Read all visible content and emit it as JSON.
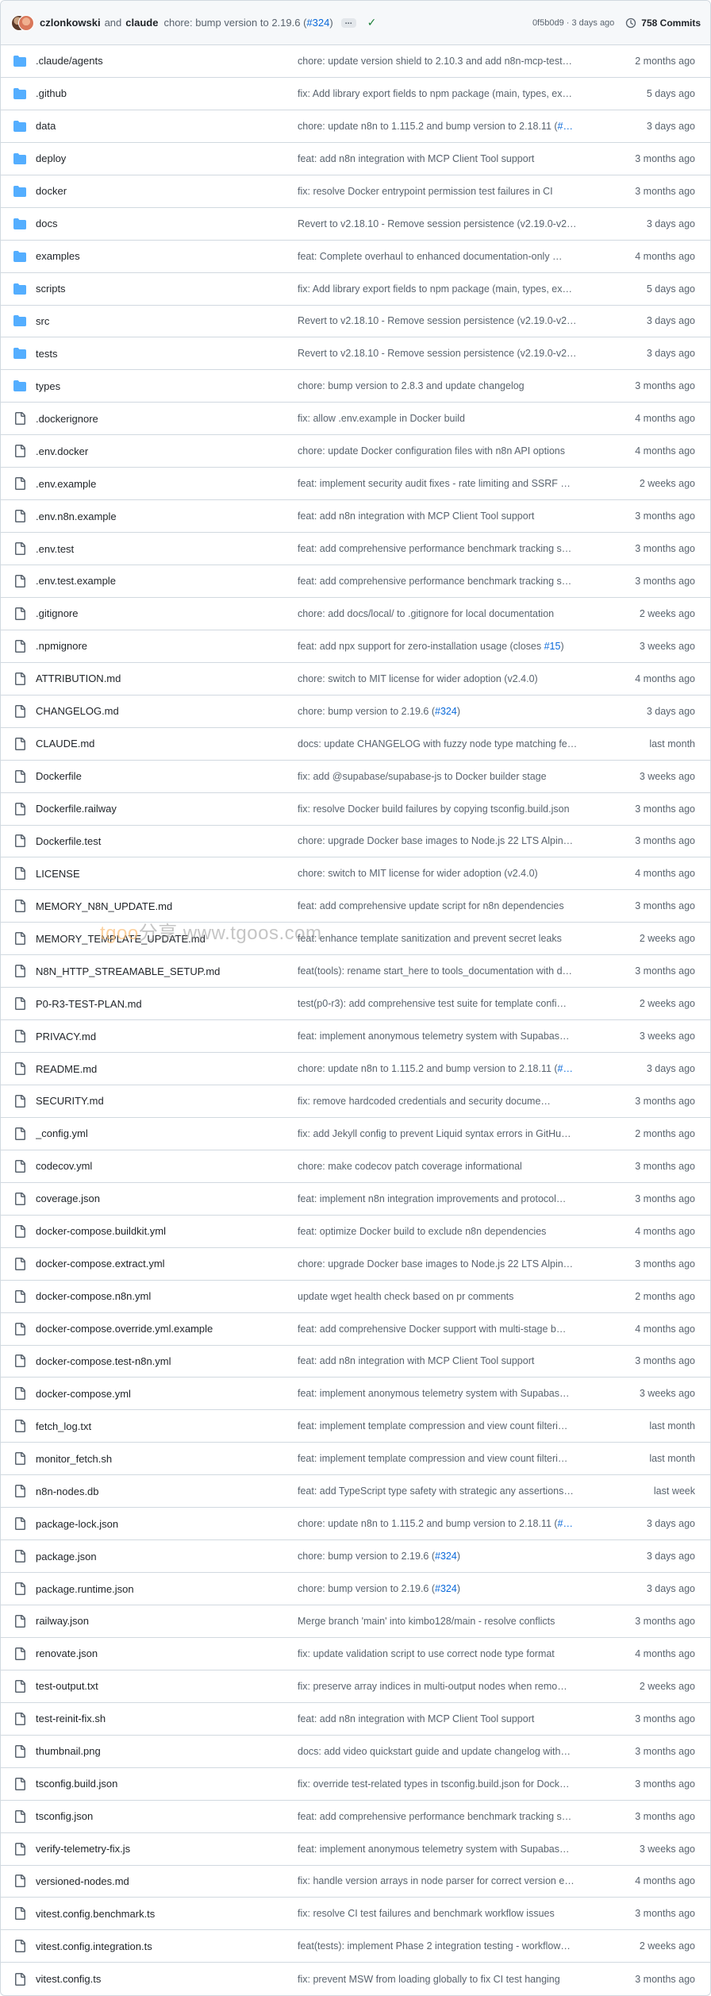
{
  "header": {
    "author1": "czlonkowski",
    "and": "and",
    "author2": "claude",
    "message": "chore: bump version to 2.19.6 (",
    "pr_link": "#324",
    "message_end": ")",
    "ellipsis": "...",
    "sha_time": "0f5b0d9 · 3 days ago",
    "commits": "758 Commits",
    "accent_color": "#0969da",
    "check_color": "#1a7f37"
  },
  "watermark": {
    "brand": "tgoo",
    "cn": "分享",
    "url": "www.tgoos.com"
  },
  "files": [
    {
      "type": "folder",
      "name": ".claude/agents",
      "commit": "chore: update version shield to 2.10.3 and add n8n-mcp-test…",
      "date": "2 months ago"
    },
    {
      "type": "folder",
      "name": ".github",
      "commit": "fix: Add library export fields to npm package (main, types, ex…",
      "date": "5 days ago"
    },
    {
      "type": "folder",
      "name": "data",
      "commit": "chore: update n8n to 1.115.2 and bump version to 2.18.11 (#…",
      "date": "3 days ago"
    },
    {
      "type": "folder",
      "name": "deploy",
      "commit": "feat: add n8n integration with MCP Client Tool support",
      "date": "3 months ago"
    },
    {
      "type": "folder",
      "name": "docker",
      "commit": "fix: resolve Docker entrypoint permission test failures in CI",
      "date": "3 months ago"
    },
    {
      "type": "folder",
      "name": "docs",
      "commit": "Revert to v2.18.10 - Remove session persistence (v2.19.0-v2…",
      "date": "3 days ago"
    },
    {
      "type": "folder",
      "name": "examples",
      "commit": "feat: Complete overhaul to enhanced documentation-only …",
      "date": "4 months ago"
    },
    {
      "type": "folder",
      "name": "scripts",
      "commit": "fix: Add library export fields to npm package (main, types, ex…",
      "date": "5 days ago"
    },
    {
      "type": "folder",
      "name": "src",
      "commit": "Revert to v2.18.10 - Remove session persistence (v2.19.0-v2…",
      "date": "3 days ago"
    },
    {
      "type": "folder",
      "name": "tests",
      "commit": "Revert to v2.18.10 - Remove session persistence (v2.19.0-v2…",
      "date": "3 days ago"
    },
    {
      "type": "folder",
      "name": "types",
      "commit": "chore: bump version to 2.8.3 and update changelog",
      "date": "3 months ago"
    },
    {
      "type": "file",
      "name": ".dockerignore",
      "commit": "fix: allow .env.example in Docker build",
      "date": "4 months ago"
    },
    {
      "type": "file",
      "name": ".env.docker",
      "commit": "chore: update Docker configuration files with n8n API options",
      "date": "4 months ago"
    },
    {
      "type": "file",
      "name": ".env.example",
      "commit": "feat: implement security audit fixes - rate limiting and SSRF …",
      "date": "2 weeks ago"
    },
    {
      "type": "file",
      "name": ".env.n8n.example",
      "commit": "feat: add n8n integration with MCP Client Tool support",
      "date": "3 months ago"
    },
    {
      "type": "file",
      "name": ".env.test",
      "commit": "feat: add comprehensive performance benchmark tracking s…",
      "date": "3 months ago"
    },
    {
      "type": "file",
      "name": ".env.test.example",
      "commit": "feat: add comprehensive performance benchmark tracking s…",
      "date": "3 months ago"
    },
    {
      "type": "file",
      "name": ".gitignore",
      "commit": "chore: add docs/local/ to .gitignore for local documentation",
      "date": "2 weeks ago"
    },
    {
      "type": "file",
      "name": ".npmignore",
      "commit": "feat: add npx support for zero-installation usage (closes #15)",
      "date": "3 weeks ago"
    },
    {
      "type": "file",
      "name": "ATTRIBUTION.md",
      "commit": "chore: switch to MIT license for wider adoption (v2.4.0)",
      "date": "4 months ago"
    },
    {
      "type": "file",
      "name": "CHANGELOG.md",
      "commit": "chore: bump version to 2.19.6 (#324)",
      "date": "3 days ago"
    },
    {
      "type": "file",
      "name": "CLAUDE.md",
      "commit": "docs: update CHANGELOG with fuzzy node type matching fe…",
      "date": "last month"
    },
    {
      "type": "file",
      "name": "Dockerfile",
      "commit": "fix: add @supabase/supabase-js to Docker builder stage",
      "date": "3 weeks ago"
    },
    {
      "type": "file",
      "name": "Dockerfile.railway",
      "commit": "fix: resolve Docker build failures by copying tsconfig.build.json",
      "date": "3 months ago"
    },
    {
      "type": "file",
      "name": "Dockerfile.test",
      "commit": "chore: upgrade Docker base images to Node.js 22 LTS Alpin…",
      "date": "3 months ago"
    },
    {
      "type": "file",
      "name": "LICENSE",
      "commit": "chore: switch to MIT license for wider adoption (v2.4.0)",
      "date": "4 months ago"
    },
    {
      "type": "file",
      "name": "MEMORY_N8N_UPDATE.md",
      "commit": "feat: add comprehensive update script for n8n dependencies",
      "date": "3 months ago"
    },
    {
      "type": "file",
      "name": "MEMORY_TEMPLATE_UPDATE.md",
      "commit": "feat: enhance template sanitization and prevent secret leaks",
      "date": "2 weeks ago"
    },
    {
      "type": "file",
      "name": "N8N_HTTP_STREAMABLE_SETUP.md",
      "commit": "feat(tools): rename start_here to tools_documentation with d…",
      "date": "3 months ago"
    },
    {
      "type": "file",
      "name": "P0-R3-TEST-PLAN.md",
      "commit": "test(p0-r3): add comprehensive test suite for template confi…",
      "date": "2 weeks ago"
    },
    {
      "type": "file",
      "name": "PRIVACY.md",
      "commit": "feat: implement anonymous telemetry system with Supabas…",
      "date": "3 weeks ago"
    },
    {
      "type": "file",
      "name": "README.md",
      "commit": "chore: update n8n to 1.115.2 and bump version to 2.18.11 (#…",
      "date": "3 days ago"
    },
    {
      "type": "file",
      "name": "SECURITY.md",
      "commit": "fix: remove hardcoded credentials and security docume…",
      "date": "3 months ago"
    },
    {
      "type": "file",
      "name": "_config.yml",
      "commit": "fix: add Jekyll config to prevent Liquid syntax errors in GitHu…",
      "date": "2 months ago"
    },
    {
      "type": "file",
      "name": "codecov.yml",
      "commit": "chore: make codecov patch coverage informational",
      "date": "3 months ago"
    },
    {
      "type": "file",
      "name": "coverage.json",
      "commit": "feat: implement n8n integration improvements and protocol…",
      "date": "3 months ago"
    },
    {
      "type": "file",
      "name": "docker-compose.buildkit.yml",
      "commit": "feat: optimize Docker build to exclude n8n dependencies",
      "date": "4 months ago"
    },
    {
      "type": "file",
      "name": "docker-compose.extract.yml",
      "commit": "chore: upgrade Docker base images to Node.js 22 LTS Alpin…",
      "date": "3 months ago"
    },
    {
      "type": "file",
      "name": "docker-compose.n8n.yml",
      "commit": "update wget health check based on pr comments",
      "date": "2 months ago"
    },
    {
      "type": "file",
      "name": "docker-compose.override.yml.example",
      "commit": "feat: add comprehensive Docker support with multi-stage b…",
      "date": "4 months ago"
    },
    {
      "type": "file",
      "name": "docker-compose.test-n8n.yml",
      "commit": "feat: add n8n integration with MCP Client Tool support",
      "date": "3 months ago"
    },
    {
      "type": "file",
      "name": "docker-compose.yml",
      "commit": "feat: implement anonymous telemetry system with Supabas…",
      "date": "3 weeks ago"
    },
    {
      "type": "file",
      "name": "fetch_log.txt",
      "commit": "feat: implement template compression and view count filteri…",
      "date": "last month"
    },
    {
      "type": "file",
      "name": "monitor_fetch.sh",
      "commit": "feat: implement template compression and view count filteri…",
      "date": "last month"
    },
    {
      "type": "file",
      "name": "n8n-nodes.db",
      "commit": "feat: add TypeScript type safety with strategic any assertions…",
      "date": "last week"
    },
    {
      "type": "file",
      "name": "package-lock.json",
      "commit": "chore: update n8n to 1.115.2 and bump version to 2.18.11 (#…",
      "date": "3 days ago"
    },
    {
      "type": "file",
      "name": "package.json",
      "commit": "chore: bump version to 2.19.6 (#324)",
      "date": "3 days ago"
    },
    {
      "type": "file",
      "name": "package.runtime.json",
      "commit": "chore: bump version to 2.19.6 (#324)",
      "date": "3 days ago"
    },
    {
      "type": "file",
      "name": "railway.json",
      "commit": "Merge branch 'main' into kimbo128/main - resolve conflicts",
      "date": "3 months ago"
    },
    {
      "type": "file",
      "name": "renovate.json",
      "commit": "fix: update validation script to use correct node type format",
      "date": "4 months ago"
    },
    {
      "type": "file",
      "name": "test-output.txt",
      "commit": "fix: preserve array indices in multi-output nodes when remo…",
      "date": "2 weeks ago"
    },
    {
      "type": "file",
      "name": "test-reinit-fix.sh",
      "commit": "feat: add n8n integration with MCP Client Tool support",
      "date": "3 months ago"
    },
    {
      "type": "file",
      "name": "thumbnail.png",
      "commit": "docs: add video quickstart guide and update changelog with…",
      "date": "3 months ago"
    },
    {
      "type": "file",
      "name": "tsconfig.build.json",
      "commit": "fix: override test-related types in tsconfig.build.json for Dock…",
      "date": "3 months ago"
    },
    {
      "type": "file",
      "name": "tsconfig.json",
      "commit": "feat: add comprehensive performance benchmark tracking s…",
      "date": "3 months ago"
    },
    {
      "type": "file",
      "name": "verify-telemetry-fix.js",
      "commit": "feat: implement anonymous telemetry system with Supabas…",
      "date": "3 weeks ago"
    },
    {
      "type": "file",
      "name": "versioned-nodes.md",
      "commit": "fix: handle version arrays in node parser for correct version e…",
      "date": "4 months ago"
    },
    {
      "type": "file",
      "name": "vitest.config.benchmark.ts",
      "commit": "fix: resolve CI test failures and benchmark workflow issues",
      "date": "3 months ago"
    },
    {
      "type": "file",
      "name": "vitest.config.integration.ts",
      "commit": "feat(tests): implement Phase 2 integration testing - workflow…",
      "date": "2 weeks ago"
    },
    {
      "type": "file",
      "name": "vitest.config.ts",
      "commit": "fix: prevent MSW from loading globally to fix CI test hanging",
      "date": "3 months ago"
    }
  ]
}
